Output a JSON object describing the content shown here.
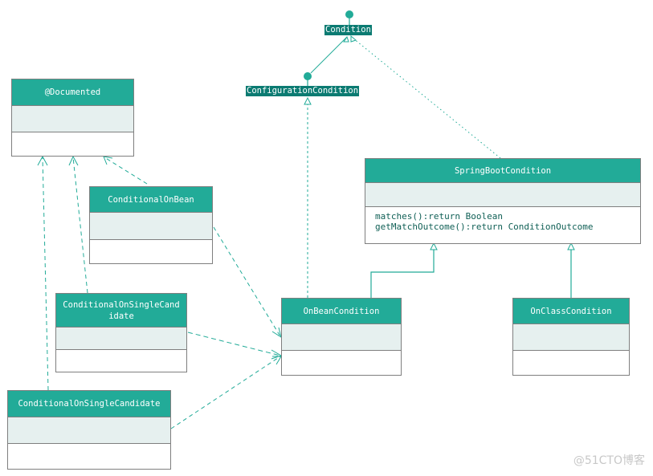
{
  "diagram": {
    "type": "uml-class-diagram",
    "colors": {
      "header": "#22ab98",
      "attributes": "#e6f0ef",
      "interface_label": "#0b7b72",
      "line": "#22ab98",
      "border": "#7f7f7f"
    },
    "interfaces": {
      "condition": "Condition",
      "configuration_condition": "ConfigurationCondition"
    },
    "classes": {
      "documented": {
        "name": "@Documented",
        "operations": []
      },
      "conditional_on_bean": {
        "name": "ConditionalOnBean",
        "operations": []
      },
      "conditional_on_single_candidate_1": {
        "name": "ConditionalOnSingleCandidate",
        "operations": []
      },
      "conditional_on_single_candidate_2": {
        "name": "ConditionalOnSingleCandidate",
        "operations": []
      },
      "spring_boot_condition": {
        "name": "SpringBootCondition",
        "operations": "matches():return Boolean\ngetMatchOutcome():return ConditionOutcome"
      },
      "on_bean_condition": {
        "name": "OnBeanCondition",
        "operations": []
      },
      "on_class_condition": {
        "name": "OnClassCondition",
        "operations": []
      }
    },
    "relationships": [
      {
        "from": "ConfigurationCondition",
        "to": "Condition",
        "type": "generalization"
      },
      {
        "from": "SpringBootCondition",
        "to": "Condition",
        "type": "realization"
      },
      {
        "from": "OnBeanCondition",
        "to": "ConfigurationCondition",
        "type": "realization"
      },
      {
        "from": "OnBeanCondition",
        "to": "SpringBootCondition",
        "type": "generalization"
      },
      {
        "from": "OnClassCondition",
        "to": "SpringBootCondition",
        "type": "generalization"
      },
      {
        "from": "ConditionalOnBean",
        "to": "@Documented",
        "type": "dependency"
      },
      {
        "from": "ConditionalOnSingleCandidate",
        "to": "@Documented",
        "type": "dependency"
      },
      {
        "from": "ConditionalOnSingleCandidate",
        "to": "@Documented",
        "type": "dependency"
      },
      {
        "from": "ConditionalOnBean",
        "to": "OnBeanCondition",
        "type": "dependency"
      },
      {
        "from": "ConditionalOnSingleCandidate",
        "to": "OnBeanCondition",
        "type": "dependency"
      },
      {
        "from": "ConditionalOnSingleCandidate",
        "to": "OnBeanCondition",
        "type": "dependency"
      }
    ]
  },
  "watermark": "@51CTO博客"
}
